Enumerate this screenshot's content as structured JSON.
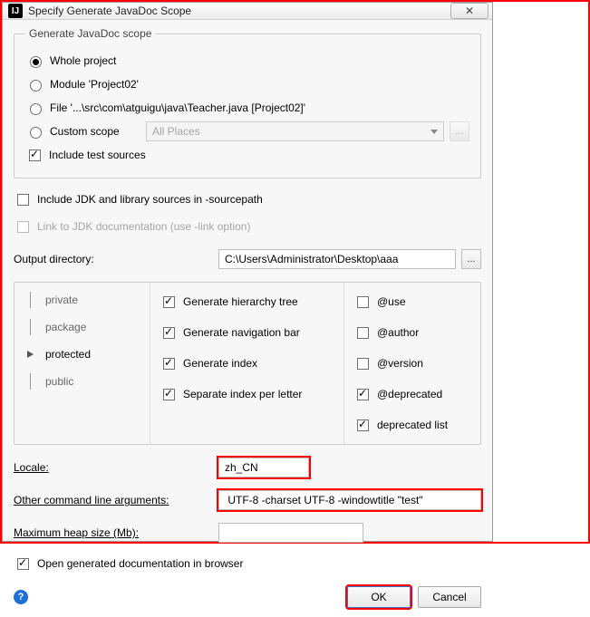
{
  "window": {
    "title": "Specify Generate JavaDoc Scope",
    "close_glyph": "✕"
  },
  "scope": {
    "legend": "Generate JavaDoc scope",
    "whole_project": "Whole project",
    "module": "Module 'Project02'",
    "file": "File '...\\src\\com\\atguigu\\java\\Teacher.java [Project02]'",
    "custom": "Custom scope",
    "custom_placeholder": "All Places",
    "include_tests": "Include test sources",
    "include_jdk": "Include JDK and library sources in -sourcepath",
    "link_jdk": "Link to JDK documentation (use -link option)"
  },
  "output": {
    "label": "Output directory:",
    "value": "C:\\Users\\Administrator\\Desktop\\aaa",
    "browse": "..."
  },
  "visibility": {
    "private": "private",
    "package": "package",
    "protected": "protected",
    "public": "public"
  },
  "mid_opts": {
    "hierarchy": "Generate hierarchy tree",
    "navbar": "Generate navigation bar",
    "index": "Generate index",
    "sep_index": "Separate index per letter"
  },
  "right_opts": {
    "use": "@use",
    "author": "@author",
    "version": "@version",
    "deprecated": "@deprecated",
    "dep_list": "deprecated list"
  },
  "locale": {
    "label": "Locale:",
    "value": "zh_CN"
  },
  "args": {
    "label": "Other command line arguments:",
    "value": " UTF-8 -charset UTF-8 -windowtitle \"test\""
  },
  "heap": {
    "label": "Maximum heap size (Mb):",
    "value": ""
  },
  "open_browser": "Open generated documentation in browser",
  "buttons": {
    "ok": "OK",
    "cancel": "Cancel"
  },
  "help_glyph": "?"
}
